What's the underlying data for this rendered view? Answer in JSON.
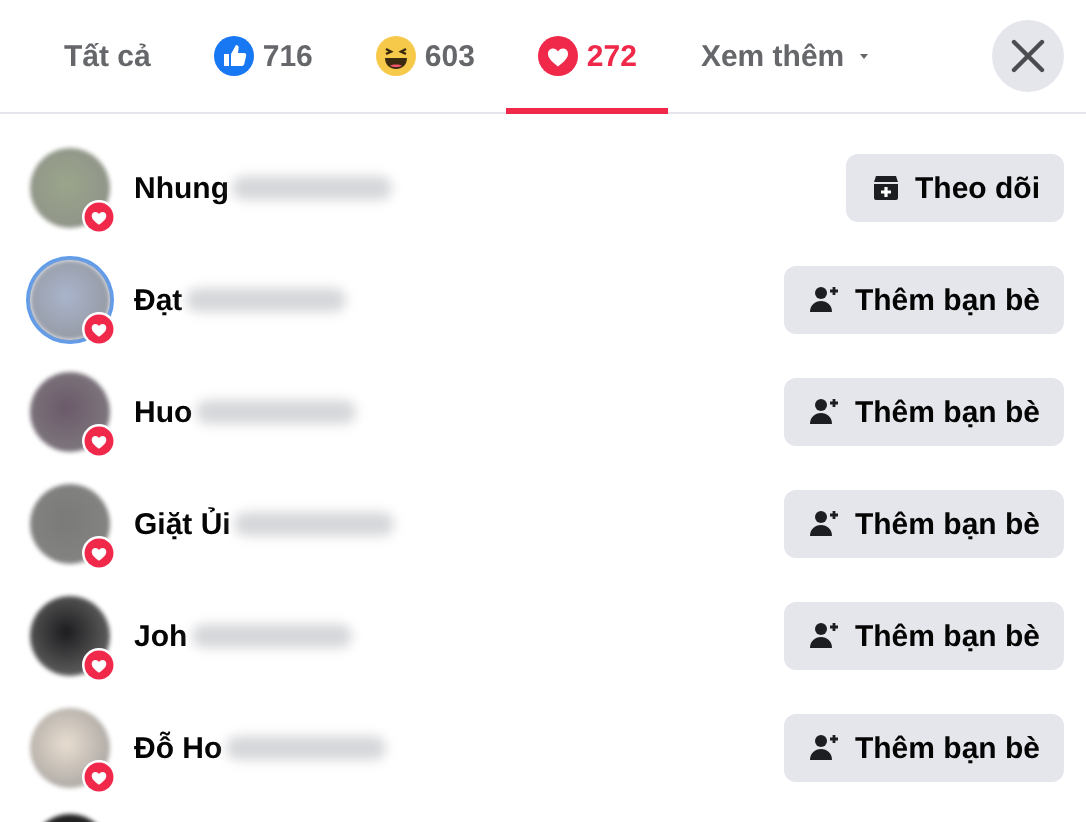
{
  "tabs": [
    {
      "kind": "all",
      "label": "Tất cả",
      "selected": false
    },
    {
      "kind": "like",
      "label": "716",
      "selected": false
    },
    {
      "kind": "haha",
      "label": "603",
      "selected": false
    },
    {
      "kind": "love",
      "label": "272",
      "selected": true
    },
    {
      "kind": "more",
      "label": "Xem thêm",
      "selected": false
    }
  ],
  "people": [
    {
      "name": "Nhung",
      "story_ring": false,
      "action": {
        "kind": "follow",
        "label": "Theo dõi"
      }
    },
    {
      "name": "Đạt",
      "story_ring": true,
      "action": {
        "kind": "add_friend",
        "label": "Thêm bạn bè"
      }
    },
    {
      "name": "Huo",
      "story_ring": false,
      "action": {
        "kind": "add_friend",
        "label": "Thêm bạn bè"
      }
    },
    {
      "name": "Giặt Ủi",
      "story_ring": false,
      "action": {
        "kind": "add_friend",
        "label": "Thêm bạn bè"
      }
    },
    {
      "name": "Joh",
      "story_ring": false,
      "action": {
        "kind": "add_friend",
        "label": "Thêm bạn bè"
      }
    },
    {
      "name": "Đỗ Ho",
      "story_ring": false,
      "action": {
        "kind": "add_friend",
        "label": "Thêm bạn bè"
      }
    }
  ]
}
